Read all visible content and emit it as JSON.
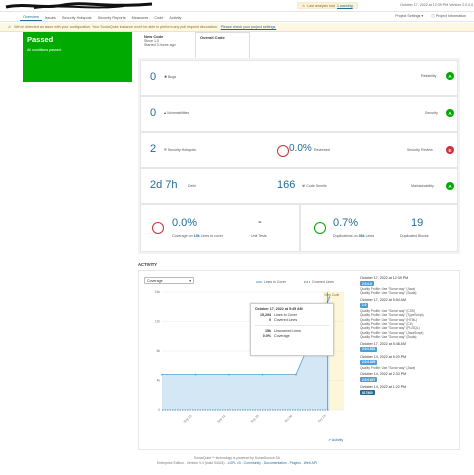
{
  "topbar": {
    "warning_text": "Last analysis had",
    "warning_link": "1 warning",
    "analysis_date": "October 17, 2022 at 12:39 PM",
    "version": "Version 2.0.0.0"
  },
  "nav": {
    "tabs": [
      "Overview",
      "Issues",
      "Security Hotspots",
      "Security Reports",
      "Measures",
      "Code",
      "Activity"
    ],
    "active_tab": "Overview",
    "project_settings": "Project Settings",
    "project_information": "Project Information"
  },
  "banner": {
    "text": "We've detected an issue with your configuration. Your SonarQube instance won't be able to perform any pull request decoration.",
    "link": "Please check your project settings."
  },
  "quality_gate": {
    "status": "Passed",
    "subtitle": "All conditions passed."
  },
  "code_tabs": {
    "new_code_title": "New Code",
    "new_code_line1": "Since 1.0",
    "new_code_line2": "Started 3 hours ago",
    "overall_title": "Overall Code"
  },
  "measures": {
    "bugs": {
      "value": "0",
      "label": "Bugs",
      "rating_label": "Reliability",
      "rating": "A"
    },
    "vulnerabilities": {
      "value": "0",
      "label": "Vulnerabilities",
      "rating_label": "Security",
      "rating": "A"
    },
    "hotspots": {
      "value": "2",
      "label": "Security Hotspots",
      "reviewed": "0.0%",
      "reviewed_label": "Reviewed",
      "rating_label": "Security Review",
      "rating": "E"
    },
    "debt": {
      "value": "2d 7h",
      "label": "Debt",
      "smells": "166",
      "smells_label": "Code Smells",
      "rating_label": "Maintainability",
      "rating": "A"
    },
    "coverage": {
      "value": "0.0%",
      "label_prefix": "Coverage on",
      "lines": "15k",
      "label_suffix": "Lines to cover",
      "unit_tests": "-",
      "unit_tests_label": "Unit Tests"
    },
    "duplications": {
      "value": "0.7%",
      "label_prefix": "Duplications on",
      "lines": "36k",
      "label_suffix": "Lines",
      "blocks": "19",
      "blocks_label": "Duplicated Blocks"
    }
  },
  "activity": {
    "title": "ACTIVITY",
    "select_value": "Coverage",
    "legend_lines": "Lines to Cover",
    "legend_covered": "Covered Lines",
    "new_code_marker": "New Code",
    "view_link": "Activity",
    "tooltip": {
      "date": "October 17, 2022 at 5:45 AM",
      "rows1": [
        {
          "n": "15,294",
          "label": "Lines to Cover"
        },
        {
          "n": "0",
          "label": "Covered Lines"
        }
      ],
      "rows2": [
        {
          "n": "15k",
          "label": "Uncovered Lines"
        },
        {
          "n": "0.0%",
          "label": "Coverage"
        }
      ]
    }
  },
  "chart_data": {
    "type": "area",
    "x": [
      "Sep 15",
      "Sep 22",
      "Sep 29",
      "Oct 06",
      "Oct 13",
      "Oct 17"
    ],
    "yticks": [
      "0",
      "4k",
      "8k",
      "12k",
      "16k"
    ],
    "ylim": [
      0,
      16000
    ],
    "series": [
      {
        "name": "Lines to Cover",
        "values": [
          4800,
          4800,
          4800,
          4800,
          4800,
          15294
        ]
      },
      {
        "name": "Covered Lines",
        "values": [
          0,
          0,
          0,
          0,
          0,
          0
        ]
      }
    ],
    "colors": {
      "lines": "#4b9fd5",
      "covered": "#236a97",
      "area": "#d4e7f5",
      "newcode": "#fdf6d8"
    }
  },
  "events": [
    {
      "date": "October 17, 2022 at 12:39 PM",
      "badge": "2.0.0.0",
      "profiles": [
        "Quality Profile: Use \"Sonar way\" (Java)",
        "Quality Profile: Use \"Sonar way\" (Scala)"
      ]
    },
    {
      "date": "October 17, 2022 at 5:54 AM",
      "badge": "1.0",
      "profiles": [
        "Quality Profile: Use \"Sonar way\" (CSS)",
        "Quality Profile: Use \"Sonar way\" (TypeScript)",
        "Quality Profile: Use \"Sonar way\" (HTML)",
        "Quality Profile: Use \"Sonar way\" (C#)",
        "Quality Profile: Use \"Sonar way\" (PL/SQL)",
        "Quality Profile: Use \"Sonar way\" (JavaScript)",
        "Quality Profile: Use \"Sonar way\" (Scala)"
      ]
    },
    {
      "date": "October 17, 2022 at 5:48 AM",
      "badge": "2.0.0.631",
      "profiles": []
    },
    {
      "date": "October 14, 2022 at 5:20 PM",
      "badge": "2.0.0.629",
      "profiles": [
        "Quality Profile: Use \"Sonar way\" (Java)"
      ]
    },
    {
      "date": "October 14, 2022 at 2:33 PM",
      "badge": "2.0.0.627",
      "profiles": []
    },
    {
      "date": "October 14, 2022 at 1:22 PM",
      "badge": "817560",
      "profiles": []
    }
  ],
  "footer": {
    "line1": "SonarQube™ technology is powered by SonarSource SA",
    "edition": "Enterprise Edition",
    "version": "Version 9.4 (build 54424)",
    "license": "LGPL v3",
    "community": "Community",
    "docs": "Documentation",
    "plugins": "Plugins",
    "api": "Web API"
  }
}
